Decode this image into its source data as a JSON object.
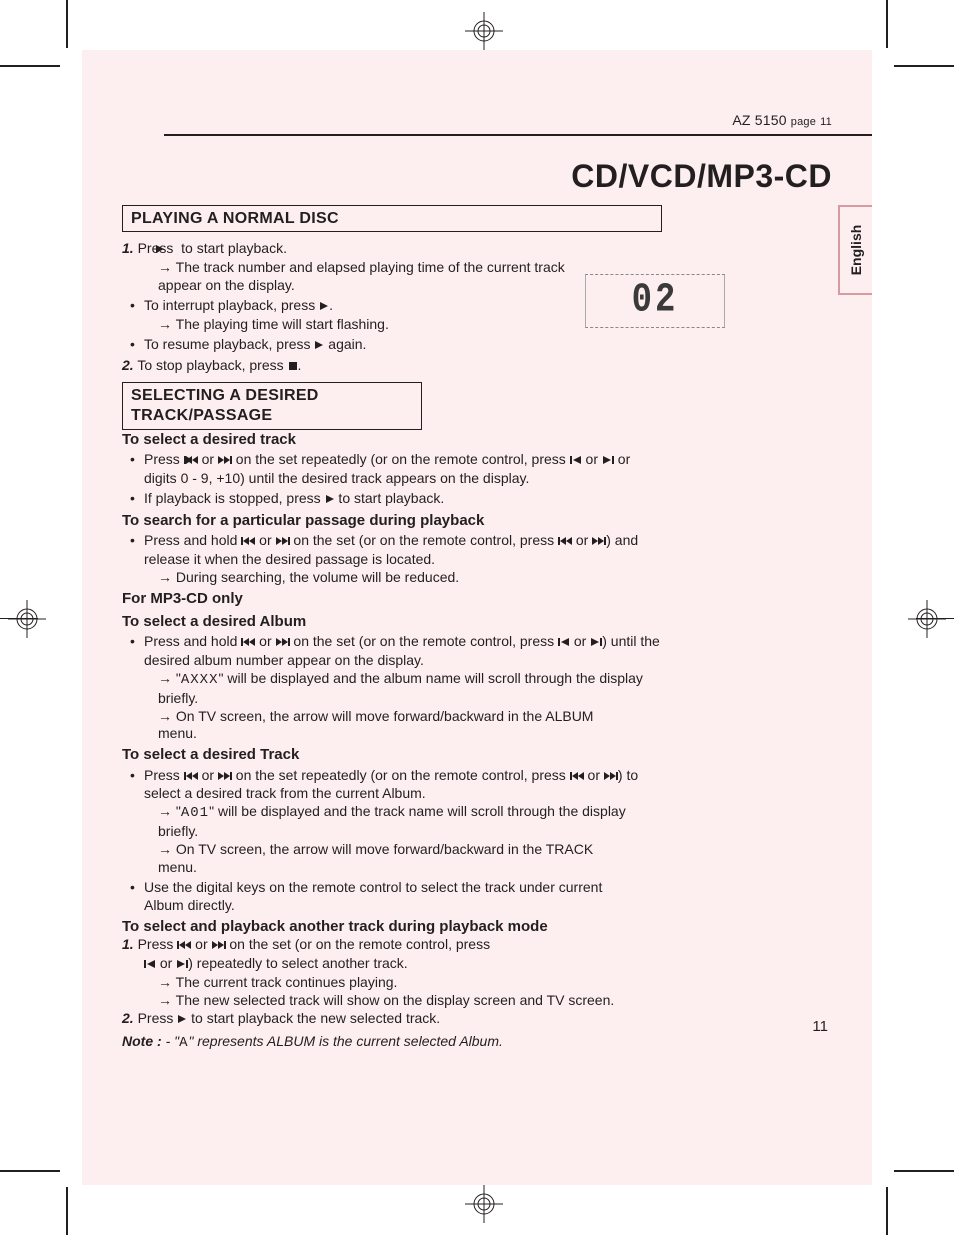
{
  "header": {
    "model": "AZ 5150",
    "pageword": "page",
    "pagenum": "11"
  },
  "title": "CD/VCD/MP3-CD",
  "tab": "English",
  "display": "02",
  "sec1": {
    "h": "PLAYING A NORMAL DISC",
    "l1a": "1.",
    "l1b": " Press ",
    "l1c": " to start playback.",
    "l1d": "The track number and elapsed playing time of the current track appear on the display.",
    "l2a": "To interrupt playback, press ",
    "l2b": ".",
    "l2c": "The playing time will start flashing.",
    "l3a": "To resume playback, press ",
    "l3b": " again.",
    "l4a": "2.",
    "l4b": " To stop playback, press ",
    "l4c": "."
  },
  "sec2": {
    "h": "SELECTING A DESIRED TRACK/PASSAGE",
    "s1": "To select a desired track",
    "l1a": "Press ",
    "l1b": " or ",
    "l1c": " on the set repeatedly (or on the remote control, press ",
    "l1d": " or ",
    "l1e": " or digits 0 - 9, +10) until the desired track appears on the display.",
    "l2a": "If playback is stopped, press ",
    "l2b": " to start playback.",
    "s2": "To search for a particular passage during playback",
    "l3a": "Press and hold ",
    "l3b": " or ",
    "l3c": " on the set (or on the remote control, press ",
    "l3d": " or ",
    "l3e": ") and release it when the desired passage is located.",
    "l3f": "During searching, the volume will be reduced.",
    "s3": "For MP3-CD only",
    "s4": "To select a desired Album",
    "l4a": "Press and hold ",
    "l4b": " or ",
    "l4c": " on the set (or on the remote control, press ",
    "l4d": " or ",
    "l4e": ") until the desired album number appear on the display.",
    "l4f": "\"",
    "l4g": "\" will be displayed and the album name will scroll through the display briefly.",
    "seg1": "AXXX",
    "l4h": "On TV screen, the arrow will move forward/backward in the ALBUM menu.",
    "s5": "To select a desired Track",
    "l5a": "Press ",
    "l5b": " or ",
    "l5c": " on the set repeatedly (or on the remote control, press ",
    "l5d": " or ",
    "l5e": ") to select a desired track from the current Album.",
    "l5f": "\"",
    "l5g": "\" will be displayed and the track name will scroll through the display briefly.",
    "seg2": "A01",
    "l5h": "On TV screen, the arrow will move forward/backward in the TRACK menu.",
    "l5i": "Use the digital keys on the remote control to select the track under current Album directly.",
    "s6": "To select and playback another track during playback mode",
    "l6a": "1.",
    "l6b": " Press ",
    "l6c": " or ",
    "l6d": " on the set (or on the remote control, press ",
    "l6e": " or ",
    "l6f": ") repeatedly to select another track.",
    "l6g": "The current track continues playing.",
    "l6h": "The new selected track will show on the display screen and TV screen.",
    "l7a": "2.",
    "l7b": " Press ",
    "l7c": " to start playback the new selected track.",
    "noteL": "Note : ",
    "noteD": "- \"",
    "noteSeg": "A",
    "noteT": "\" represents ALBUM is the current selected Album."
  },
  "footer": {
    "pagenum": "11"
  }
}
